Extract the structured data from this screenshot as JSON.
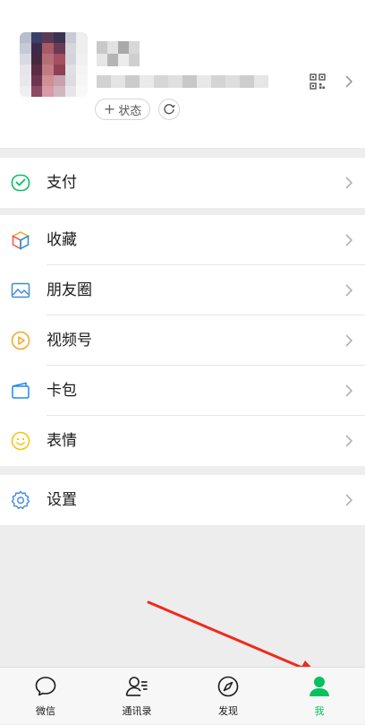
{
  "profile": {
    "status_label": "状态"
  },
  "menu": {
    "pay": "支付",
    "favorites": "收藏",
    "moments": "朋友圈",
    "channels": "视频号",
    "cards": "卡包",
    "stickers": "表情",
    "settings": "设置"
  },
  "tabbar": [
    {
      "label": "微信",
      "icon": "chat-icon"
    },
    {
      "label": "通讯录",
      "icon": "contacts-icon"
    },
    {
      "label": "发现",
      "icon": "compass-icon"
    },
    {
      "label": "我",
      "icon": "person-icon",
      "active": true
    }
  ],
  "colors": {
    "accent": "#07c160",
    "arrow": "#f02a1a",
    "background": "#ededed"
  }
}
